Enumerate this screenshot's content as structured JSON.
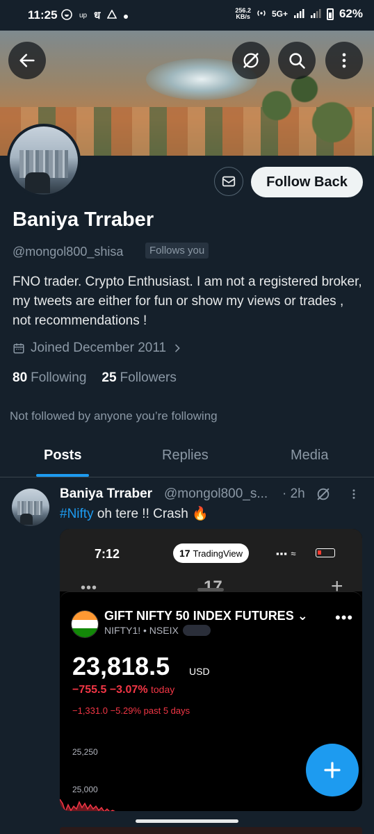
{
  "status_bar": {
    "time": "11:25",
    "net_speed_value": "256.2",
    "net_speed_unit": "KB/s",
    "network": "5G+",
    "battery": "62%",
    "left_icons": [
      "whatsapp-icon",
      "up-icon",
      "dha-icon",
      "warning-icon",
      "dot-icon"
    ],
    "left_up": "up",
    "left_dha": "ध"
  },
  "profile": {
    "name": "Baniya Trraber",
    "handle": "@mongol800_shisa",
    "follows_you": "Follows you",
    "bio": "FNO trader.  Crypto Enthusiast. I am not a registered broker, my tweets are either for fun or show my views or trades , not recommendations !",
    "joined": "Joined December 2011",
    "following_count": "80",
    "following_label": "Following",
    "followers_count": "25",
    "followers_label": "Followers",
    "not_followed": "Not followed by anyone you’re following",
    "follow_button": "Follow Back"
  },
  "tabs": [
    {
      "label": "Posts",
      "active": true
    },
    {
      "label": "Replies",
      "active": false
    },
    {
      "label": "Media",
      "active": false
    }
  ],
  "post": {
    "name": "Baniya Trraber",
    "handle": "@mongol800_s...",
    "time": "· 2h",
    "hashtag": "#Nifty",
    "text": " oh tere !! Crash 🔥",
    "media": {
      "phone_time": "7:12",
      "app_badge": "TradingView",
      "app_badge_logo": "17",
      "header_logo": "17",
      "instrument": "GIFT NIFTY 50 INDEX FUTURES",
      "symbol": "NIFTY1! • NSEIX",
      "price": "23,818.5",
      "currency": "USD",
      "change_today": "−755.5 −3.07%",
      "change_today_label": "today",
      "change_5d": "−1,331.0 −5.29% past 5 days",
      "y_labels": [
        "25,250",
        "25,000"
      ]
    }
  },
  "colors": {
    "background": "#15202b",
    "accent": "#1d9bf0",
    "muted": "#8b98a5",
    "loss": "#f23645"
  }
}
